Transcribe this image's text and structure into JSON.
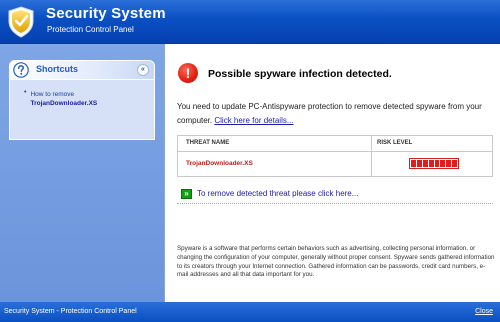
{
  "app": {
    "title": "Security System",
    "subtitle": "Protection Control Panel"
  },
  "sidebar": {
    "panel_title": "Shortcuts",
    "collapse_glyph": "«",
    "items": [
      {
        "prefix": "How to remove",
        "name": "TrojanDownloader.XS"
      }
    ]
  },
  "alert": {
    "icon_glyph": "!",
    "title": "Possible spyware infection detected.",
    "description": "You need to update PC-Antispyware protection to remove detected spyware from your computer.",
    "details_link": "Click here for details..."
  },
  "threats": {
    "col_name": "THREAT NAME",
    "col_risk": "RISK LEVEL",
    "rows": [
      {
        "name": "TrojanDownloader.XS",
        "risk_segments": 8,
        "risk_level": 1.0
      }
    ]
  },
  "remove": {
    "icon_glyph": "»",
    "link": "To remove detected threat please click here..."
  },
  "footnote": "Spyware is a software that performs certain behaviors such as advertising, collecting personal information, or changing the configuration of your computer, generally without proper consent. Spyware sends gathered information to its creators through your Internet connection. Gathered information can be passwords, credit card numbers, e-mail addresses and all that data important for you.",
  "statusbar": {
    "text": "Security System - Protection Control Panel",
    "close_label": "Close"
  },
  "colors": {
    "titlebar": "#0a4fc2",
    "sidebar": "#7ea6e6",
    "alert_red": "#e22414",
    "link_blue": "#1c1ca8",
    "threat_red": "#c21a1a"
  },
  "icons": {
    "app_icon": "shield-icon",
    "panel_icon": "question-icon",
    "alert_icon": "alert-icon",
    "remove_icon": "arrow-right-icon"
  }
}
